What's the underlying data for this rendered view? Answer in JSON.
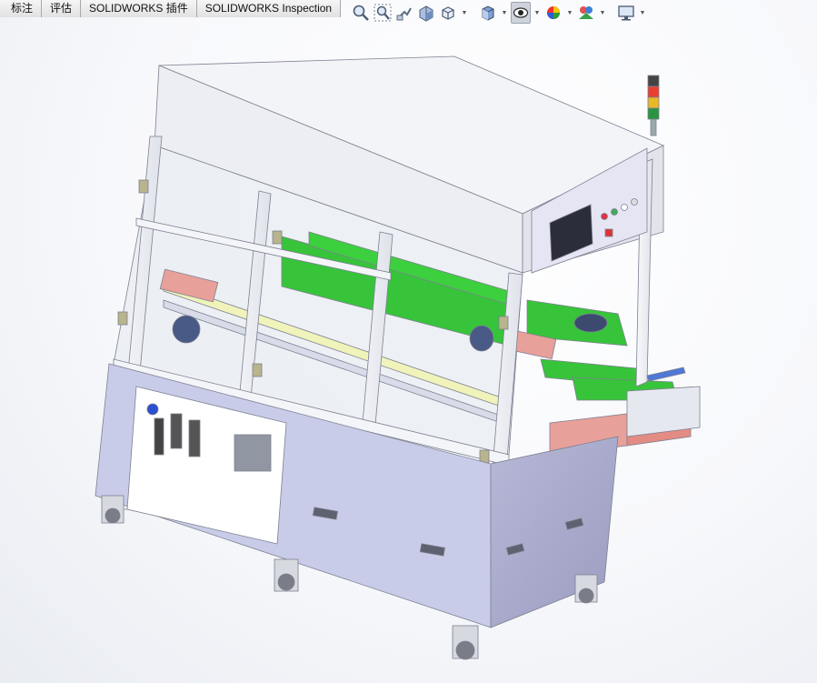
{
  "command_manager": {
    "tabs": [
      {
        "label": "标注"
      },
      {
        "label": "评估"
      },
      {
        "label": "SOLIDWORKS 插件"
      },
      {
        "label": "SOLIDWORKS Inspection"
      }
    ]
  },
  "heads_up_toolbar": {
    "items": [
      {
        "icon": "zoom-to-fit-icon"
      },
      {
        "icon": "zoom-to-area-icon"
      },
      {
        "icon": "previous-view-icon"
      },
      {
        "icon": "section-view-icon"
      },
      {
        "icon": "view-orientation-icon",
        "has_menu": true
      },
      {
        "icon": "display-style-icon",
        "has_menu": true
      },
      {
        "icon": "hide-show-items-icon",
        "has_menu": true,
        "active": true
      },
      {
        "icon": "edit-appearance-icon",
        "has_menu": true
      },
      {
        "icon": "apply-scene-icon",
        "has_menu": true
      },
      {
        "icon": "view-settings-icon",
        "has_menu": true
      }
    ]
  },
  "colors": {
    "frame": "#eef0f5",
    "base_light": "#c9cce8",
    "base_dark": "#a8aac8",
    "conveyor_green": "#37c43a",
    "panel_red": "#e8a09a",
    "motor_blue": "#4a5a86"
  }
}
